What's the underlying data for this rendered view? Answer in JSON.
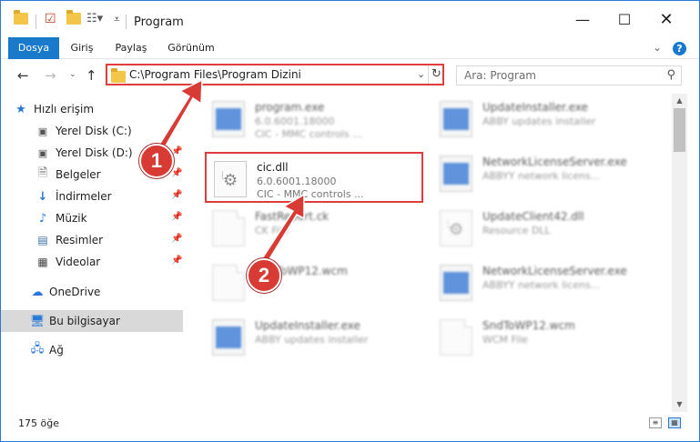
{
  "title": "Program",
  "ribbon": {
    "tabs": [
      "Dosya",
      "Giriş",
      "Paylaş",
      "Görünüm"
    ]
  },
  "address": {
    "path": "C:\\Program Files\\Program Dizini",
    "search_placeholder": "Ara: Program"
  },
  "sidebar": {
    "items": [
      {
        "label": "Hızlı erişim",
        "icon": "star-icon"
      },
      {
        "label": "Yerel Disk (C:)",
        "icon": "drive-icon"
      },
      {
        "label": "Yerel Disk (D:)",
        "icon": "drive-icon"
      },
      {
        "label": "Belgeler",
        "icon": "documents-icon"
      },
      {
        "label": "İndirmeler",
        "icon": "download-icon"
      },
      {
        "label": "Müzik",
        "icon": "music-icon"
      },
      {
        "label": "Resimler",
        "icon": "pictures-icon"
      },
      {
        "label": "Videolar",
        "icon": "video-icon"
      },
      {
        "label": "OneDrive",
        "icon": "cloud-icon"
      },
      {
        "label": "Bu bilgisayar",
        "icon": "computer-icon"
      },
      {
        "label": "Ağ",
        "icon": "network-icon"
      }
    ]
  },
  "files": [
    {
      "name": "program.exe",
      "line1": "6.0.6001.18000",
      "line2": "CIC - MMC controls ...",
      "icon": "app-icon"
    },
    {
      "name": "UpdateInstaller.exe",
      "line1": "ABBY updates installer",
      "line2": "",
      "icon": "app-icon"
    },
    {
      "name": "cic.dll",
      "line1": "6.0.6001.18000",
      "line2": "CIC - MMC controls ...",
      "icon": "dll-gear-icon"
    },
    {
      "name": "NetworkLicenseServer.exe",
      "line1": "ABBYY network licens...",
      "line2": "",
      "icon": "app-icon"
    },
    {
      "name": "FastReport.ck",
      "line1": "CK File",
      "line2": "",
      "icon": "file-icon"
    },
    {
      "name": "UpdateClient42.dll",
      "line1": "Resource DLL",
      "line2": "",
      "icon": "dll-gear-icon"
    },
    {
      "name": "SndToWP12.wcm",
      "line1": "",
      "line2": "",
      "icon": "file-icon"
    },
    {
      "name": "NetworkLicenseServer.exe",
      "line1": "ABBYY network licens...",
      "line2": "",
      "icon": "app-icon"
    },
    {
      "name": "UpdateInstaller.exe",
      "line1": "ABBY updates installer",
      "line2": "",
      "icon": "app-icon"
    },
    {
      "name": "SndToWP12.wcm",
      "line1": "WCM File",
      "line2": "",
      "icon": "file-icon"
    }
  ],
  "status": {
    "count": "175 öğe"
  },
  "annotations": {
    "step1": "1",
    "step2": "2",
    "color": "#d83b34"
  }
}
